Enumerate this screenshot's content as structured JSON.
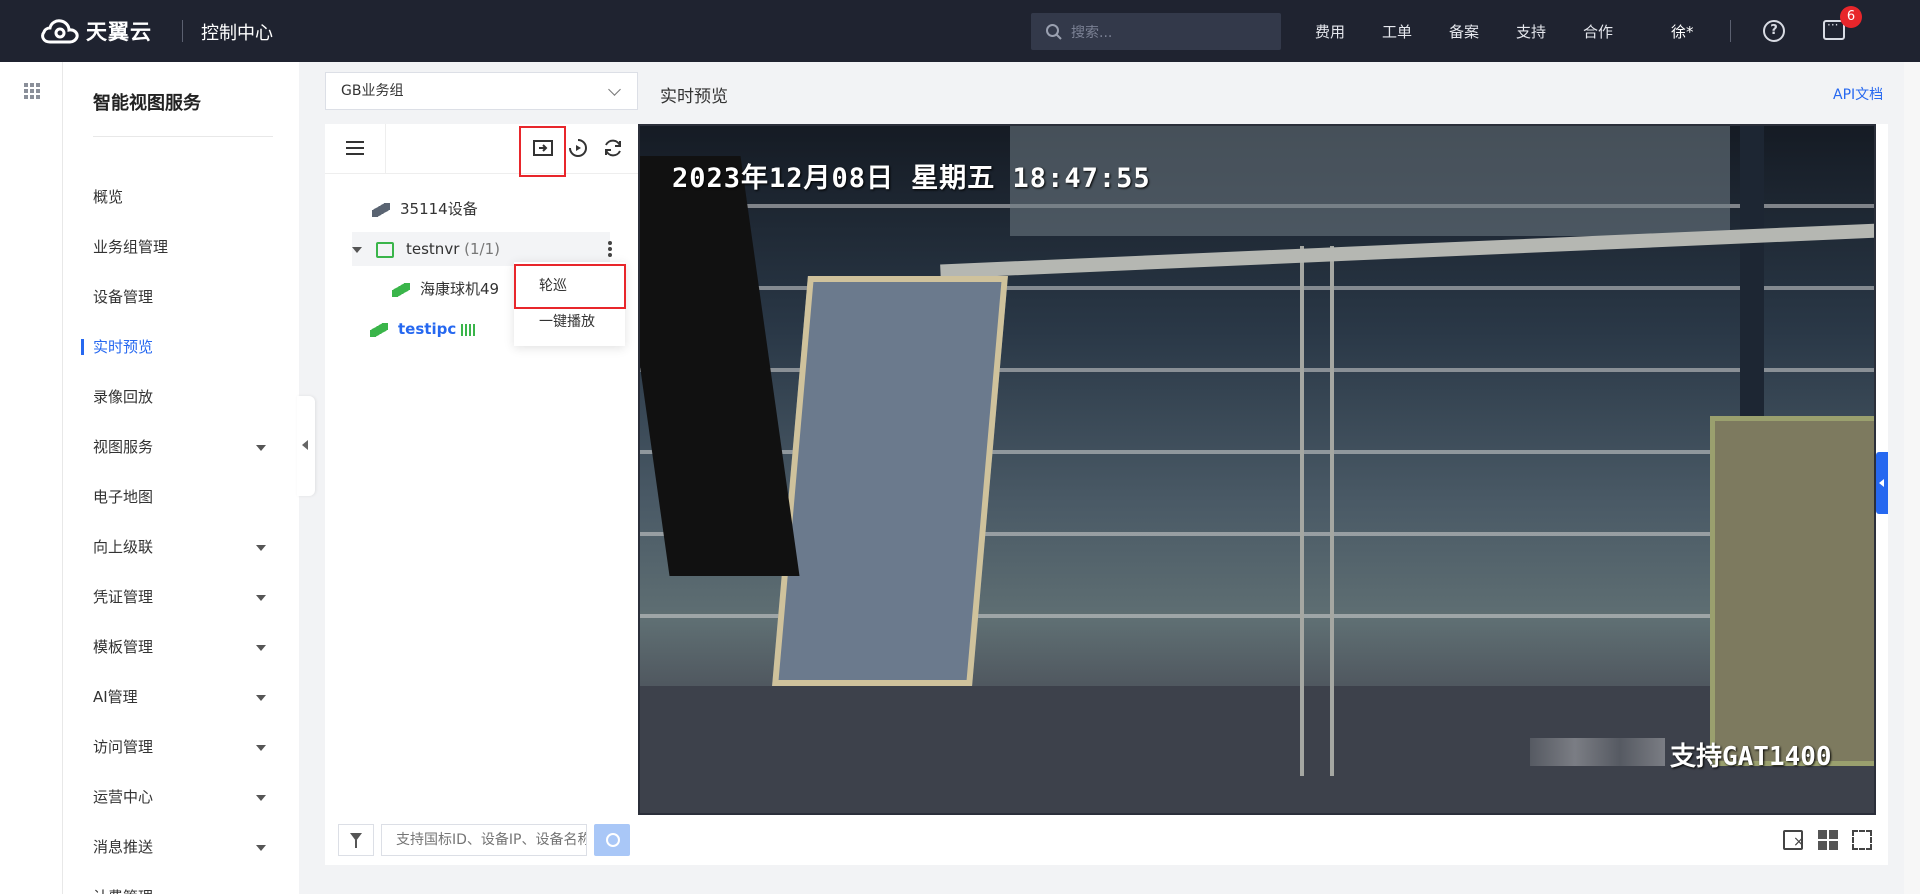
{
  "header": {
    "brand": "天翼云",
    "console_title": "控制中心",
    "search_placeholder": "搜索...",
    "nav": [
      "费用",
      "工单",
      "备案",
      "支持",
      "合作"
    ],
    "user": "徐*",
    "help_symbol": "?",
    "notification_count": "6"
  },
  "sidebar": {
    "title": "智能视图服务",
    "items": [
      {
        "label": "概览",
        "has_submenu": false,
        "active": false
      },
      {
        "label": "业务组管理",
        "has_submenu": false,
        "active": false
      },
      {
        "label": "设备管理",
        "has_submenu": false,
        "active": false
      },
      {
        "label": "实时预览",
        "has_submenu": false,
        "active": true
      },
      {
        "label": "录像回放",
        "has_submenu": false,
        "active": false
      },
      {
        "label": "视图服务",
        "has_submenu": true,
        "active": false
      },
      {
        "label": "电子地图",
        "has_submenu": false,
        "active": false
      },
      {
        "label": "向上级联",
        "has_submenu": true,
        "active": false
      },
      {
        "label": "凭证管理",
        "has_submenu": true,
        "active": false
      },
      {
        "label": "模板管理",
        "has_submenu": true,
        "active": false
      },
      {
        "label": "AI管理",
        "has_submenu": true,
        "active": false
      },
      {
        "label": "访问管理",
        "has_submenu": true,
        "active": false
      },
      {
        "label": "运营中心",
        "has_submenu": true,
        "active": false
      },
      {
        "label": "消息推送",
        "has_submenu": true,
        "active": false
      },
      {
        "label": "计费管理",
        "has_submenu": true,
        "active": false
      }
    ]
  },
  "main": {
    "group_select": "GB业务组",
    "page_title": "实时预览",
    "api_link": "API文档"
  },
  "tree": {
    "nodes": [
      {
        "label": "35114设备",
        "count": ""
      },
      {
        "label": "testnvr",
        "count": "(1/1)"
      },
      {
        "label": "海康球机49",
        "count": ""
      },
      {
        "label": "testipc",
        "count": ""
      }
    ],
    "context_menu": [
      "轮巡",
      "一键播放"
    ],
    "search_placeholder": "支持国标ID、设备IP、设备名称"
  },
  "video": {
    "osd_time": "2023年12月08日  星期五  18:47:55",
    "osd_brand": "支持GAT1400"
  },
  "colors": {
    "topbar": "#1f2330",
    "accent": "#2668f0",
    "highlight_box": "#e8262b",
    "online_green": "#3ab54a"
  }
}
